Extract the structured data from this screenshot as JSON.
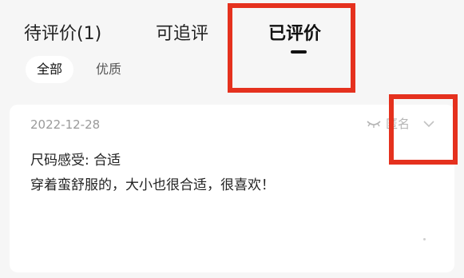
{
  "tabs": [
    {
      "label": "待评价(1)"
    },
    {
      "label": "可追评"
    },
    {
      "label": "已评价"
    }
  ],
  "filters": [
    {
      "label": "全部"
    },
    {
      "label": "优质"
    }
  ],
  "review": {
    "date": "2022-12-28",
    "anonymous_label": "匿名",
    "line1": "尺码感受: 合适",
    "line2": "穿着蛮舒服的，大小也很合适，很喜欢！"
  },
  "colors": {
    "highlight": "#e5311e",
    "muted_text": "#9a9a9a"
  },
  "icons": [
    "eye-closed-icon",
    "chevron-down-icon"
  ]
}
